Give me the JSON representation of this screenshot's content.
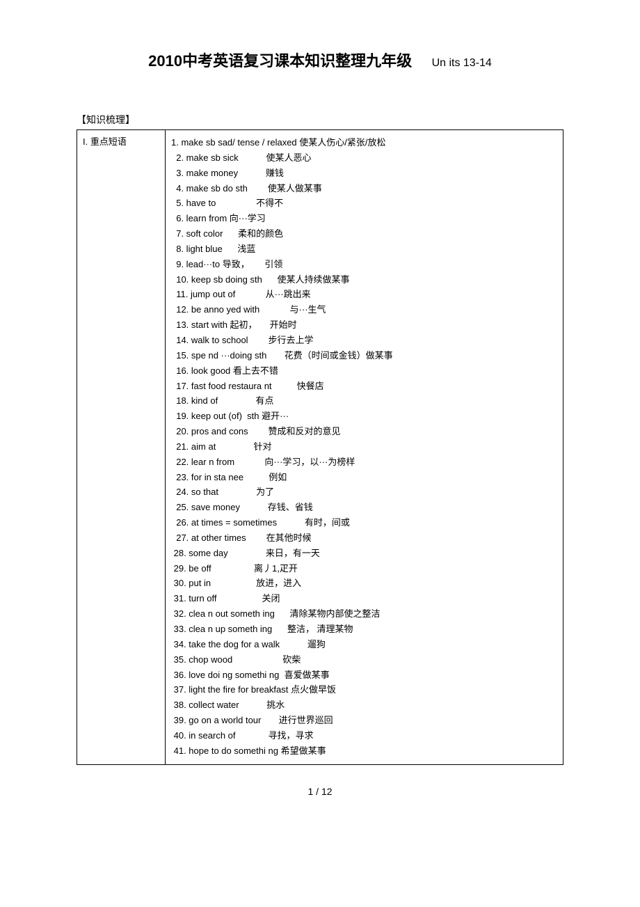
{
  "title_main": "2010中考英语复习课本知识整理九年级",
  "title_sub": "Un its 13-14",
  "section_label": "【知识梳理】",
  "left_heading": "I.   重点短语",
  "footer": "1 / 12",
  "items": [
    {
      "en": "1. make sb sad/ tense / relaxed ",
      "cn": "使某人伤心/紧张/放松"
    },
    {
      "en": "  2. make sb sick           ",
      "cn": "使某人恶心"
    },
    {
      "en": "  3. make money           ",
      "cn": "赚钱"
    },
    {
      "en": "  4. make sb do sth        ",
      "cn": "使某人做某事"
    },
    {
      "en": "  5. have to                ",
      "cn": "不得不"
    },
    {
      "en": "  6. learn from 向···学习",
      "cn": ""
    },
    {
      "en": "  7. soft color      ",
      "cn": "柔和的颜色"
    },
    {
      "en": "  8. light blue      ",
      "cn": "浅蓝"
    },
    {
      "en": "  9. lead···to 导致，      ",
      "cn": "引领"
    },
    {
      "en": "  10. keep sb doing sth      ",
      "cn": "使某人持续做某事"
    },
    {
      "en": "  11. jump out of            ",
      "cn": "从···跳出来"
    },
    {
      "en": "  12. be anno yed with            ",
      "cn": "与···生气"
    },
    {
      "en": "  13. start with 起初，     ",
      "cn": "开始时"
    },
    {
      "en": "  14. walk to school        ",
      "cn": "步行去上学"
    },
    {
      "en": "  15. spe nd ···doing sth       ",
      "cn": "花费（时间或金钱）做某事"
    },
    {
      "en": "  16. look good 看上去不错",
      "cn": ""
    },
    {
      "en": "  17. fast food restaura nt          ",
      "cn": "快餐店"
    },
    {
      "en": "  18. kind of               ",
      "cn": "有点"
    },
    {
      "en": "  19. keep out (of)  sth 避开···",
      "cn": ""
    },
    {
      "en": "  20. pros and cons        ",
      "cn": "赞成和反对的意见"
    },
    {
      "en": "  21. aim at               ",
      "cn": "针对"
    },
    {
      "en": "  22. lear n from            ",
      "cn": "向···学习，以···为榜样"
    },
    {
      "en": "  23. for in sta nee          ",
      "cn": "例如"
    },
    {
      "en": "  24. so that               ",
      "cn": "为了"
    },
    {
      "en": "  25. save money           ",
      "cn": "存钱、省钱"
    },
    {
      "en": "  26. at times = sometimes           ",
      "cn": "有时，间或"
    },
    {
      "en": "  27. at other times        ",
      "cn": "在其他时候"
    },
    {
      "en": " 28. some day               ",
      "cn": "来日，有一天"
    },
    {
      "en": " 29. be off                 ",
      "cn": "离丿1,疋开"
    },
    {
      "en": " 30. put in                  ",
      "cn": "放进，进入"
    },
    {
      "en": " 31. turn off                  ",
      "cn": "关闭"
    },
    {
      "en": " 32. clea n out someth ing      ",
      "cn": "清除某物内部使之整洁"
    },
    {
      "en": " 33. clea n up someth ing      ",
      "cn": "整洁， 清理某物"
    },
    {
      "en": " 34. take the dog for a walk           ",
      "cn": "遛狗"
    },
    {
      "en": " 35. chop wood                    ",
      "cn": "砍柴"
    },
    {
      "en": " 36. love doi ng somethi ng  ",
      "cn": "喜爱做某事"
    },
    {
      "en": " 37. light the fire for breakfast ",
      "cn": "点火做早饭"
    },
    {
      "en": " 38. collect water           ",
      "cn": "挑水"
    },
    {
      "en": " 39. go on a world tour       ",
      "cn": "进行世界巡回"
    },
    {
      "en": " 40. in search of             ",
      "cn": "寻找，寻求"
    },
    {
      "en": " 41. hope to do somethi ng ",
      "cn": "希望做某事"
    }
  ]
}
